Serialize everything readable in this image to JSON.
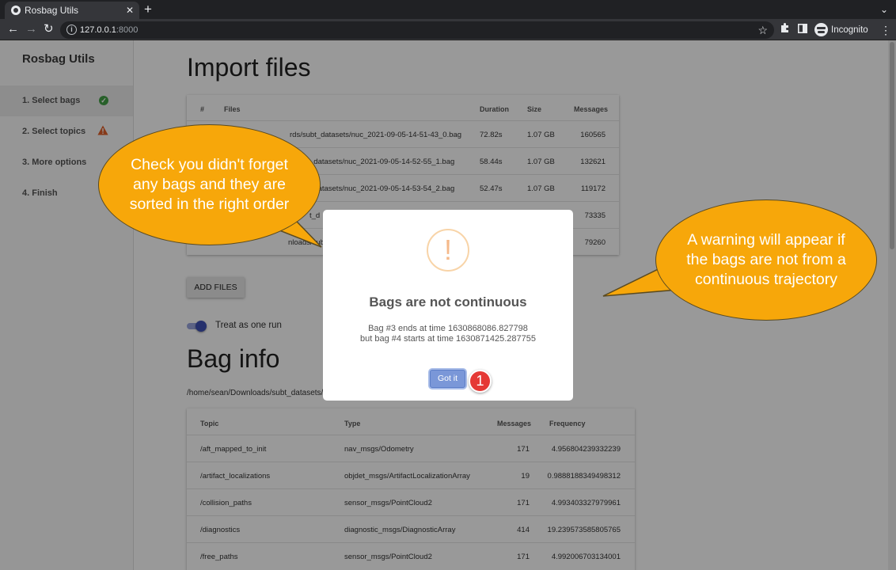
{
  "browser": {
    "tab_title": "Rosbag Utils",
    "tab_close": "✕",
    "new_tab": "+",
    "url_host": "127.0.0.1",
    "url_port": ":8000",
    "profile_label": "Incognito",
    "icons": [
      "globe-icon",
      "close-icon",
      "back-icon",
      "forward-icon",
      "reload-icon",
      "info-icon",
      "star-icon",
      "extensions-icon",
      "side-panel-icon",
      "incognito-icon",
      "menu-icon"
    ]
  },
  "sidebar": {
    "title": "Rosbag Utils",
    "steps": [
      {
        "label": "1. Select bags",
        "status": "done"
      },
      {
        "label": "2. Select topics",
        "status": "warning"
      },
      {
        "label": "3. More options",
        "status": ""
      },
      {
        "label": "4. Finish",
        "status": ""
      }
    ]
  },
  "import": {
    "heading": "Import files",
    "columns": {
      "num": "#",
      "files": "Files",
      "duration": "Duration",
      "size": "Size",
      "messages": "Messages"
    },
    "rows": [
      {
        "file": "rds/subt_datasets/nuc_2021-09-05-14-51-43_0.bag",
        "duration": "72.82s",
        "size": "1.07 GB",
        "messages": "160565"
      },
      {
        "file": "_datasets/nuc_2021-09-05-14-52-55_1.bag",
        "duration": "58.44s",
        "size": "1.07 GB",
        "messages": "132621"
      },
      {
        "file": "_datasets/nuc_2021-09-05-14-53-54_2.bag",
        "duration": "52.47s",
        "size": "1.07 GB",
        "messages": "119172"
      },
      {
        "file": "t_d",
        "duration": "",
        "size": "",
        "messages": "73335"
      },
      {
        "file": "nloads/sub",
        "duration": "",
        "size": "",
        "messages": "79260"
      }
    ],
    "add_button": "ADD FILES",
    "toggle_label": "Treat as one run",
    "toggle_on": true
  },
  "baginfo": {
    "heading": "Bag info",
    "path": "/home/sean/Downloads/subt_datasets/n",
    "columns": {
      "topic": "Topic",
      "type": "Type",
      "messages": "Messages",
      "frequency": "Frequency"
    },
    "rows": [
      {
        "topic": "/aft_mapped_to_init",
        "type": "nav_msgs/Odometry",
        "messages": "171",
        "frequency": "4.956804239332239"
      },
      {
        "topic": "/artifact_localizations",
        "type": "objdet_msgs/ArtifactLocalizationArray",
        "messages": "19",
        "frequency": "0.9888188349498312"
      },
      {
        "topic": "/collision_paths",
        "type": "sensor_msgs/PointCloud2",
        "messages": "171",
        "frequency": "4.993403327979961"
      },
      {
        "topic": "/diagnostics",
        "type": "diagnostic_msgs/DiagnosticArray",
        "messages": "414",
        "frequency": "19.239573585805765"
      },
      {
        "topic": "/free_paths",
        "type": "sensor_msgs/PointCloud2",
        "messages": "171",
        "frequency": "4.992006703134001"
      }
    ]
  },
  "modal": {
    "icon": "!",
    "title": "Bags are not continuous",
    "line1": "Bag #3 ends at time 1630868086.827798",
    "line2": "but bag #4 starts at time 1630871425.287755",
    "button": "Got it",
    "step_number": "1"
  },
  "callouts": {
    "left": "Check you didn't forget any bags and they are sorted in the right order",
    "right": "A warning will appear if the bags are not from a continuous trajectory"
  },
  "colors": {
    "callout": "#f7a70a",
    "primary": "#3f51b5",
    "success": "#43a047",
    "warning": "#e0602a",
    "badge": "#e53935"
  }
}
